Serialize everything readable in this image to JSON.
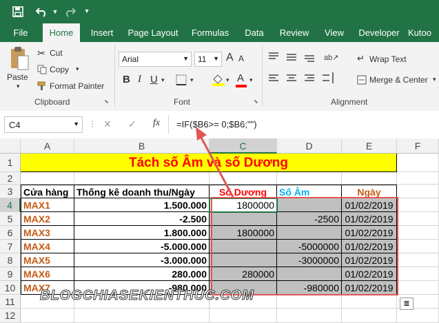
{
  "quick_access": {
    "save_icon": "save-icon",
    "undo_icon": "undo-icon",
    "redo_icon": "redo-icon",
    "more_icon": "customize-icon"
  },
  "tabs": [
    "File",
    "Home",
    "Insert",
    "Page Layout",
    "Formulas",
    "Data",
    "Review",
    "View",
    "Developer",
    "Kutoo"
  ],
  "ribbon": {
    "paste_label": "Paste",
    "cut_label": "Cut",
    "copy_label": "Copy",
    "format_painter_label": "Format Painter",
    "clipboard_group": "Clipboard",
    "font_name": "Arial",
    "font_size": "11",
    "font_group": "Font",
    "bold": "B",
    "italic": "I",
    "underline": "U",
    "grow_font": "A",
    "shrink_font": "A",
    "wrap_text_label": "Wrap Text",
    "merge_center_label": "Merge & Center",
    "alignment_group": "Alignment"
  },
  "formula_bar": {
    "name_box": "C4",
    "cancel": "✕",
    "enter": "✓",
    "fx": "fx",
    "formula": "=IF($B6>= 0;$B6;\"\")"
  },
  "columns": [
    "A",
    "B",
    "C",
    "D",
    "E",
    "F"
  ],
  "rows": [
    "1",
    "2",
    "3",
    "4",
    "5",
    "6",
    "7",
    "8",
    "9",
    "10",
    "11",
    "12"
  ],
  "sheet": {
    "title": "Tách số Âm và số Dương",
    "headers": {
      "store": "Cửa hàng",
      "revenue": "Thống kê doanh thu/Ngày",
      "positive": "Số Dương",
      "negative": "Số Âm",
      "date": "Ngày"
    },
    "data_rows": [
      {
        "store": "MAX1",
        "revenue": "1.500.000",
        "positive": "1800000",
        "negative": "",
        "date": "01/02/2019"
      },
      {
        "store": "MAX2",
        "revenue": "-2.500",
        "positive": "",
        "negative": "-2500",
        "date": "01/02/2019"
      },
      {
        "store": "MAX3",
        "revenue": "1.800.000",
        "positive": "1800000",
        "negative": "",
        "date": "01/02/2019"
      },
      {
        "store": "MAX4",
        "revenue": "-5.000.000",
        "positive": "",
        "negative": "-5000000",
        "date": "01/02/2019"
      },
      {
        "store": "MAX5",
        "revenue": "-3.000.000",
        "positive": "",
        "negative": "-3000000",
        "date": "01/02/2019"
      },
      {
        "store": "MAX6",
        "revenue": "280.000",
        "positive": "280000",
        "negative": "",
        "date": "01/02/2019"
      },
      {
        "store": "MAX7",
        "revenue": "-980.000",
        "positive": "",
        "negative": "-980000",
        "date": "01/02/2019"
      }
    ]
  },
  "watermark": "BLOGCHIASEKIENTHUC.COM",
  "colors": {
    "excel_green": "#217346",
    "title_fill": "#ffff00",
    "title_text": "#ff0000",
    "store_text": "#c55a11",
    "positive_header": "#ff0000",
    "negative_header": "#00b0f0",
    "date_header": "#c55a11",
    "highlight_border": "#e05555",
    "gray_fill": "#c0c0c0"
  }
}
